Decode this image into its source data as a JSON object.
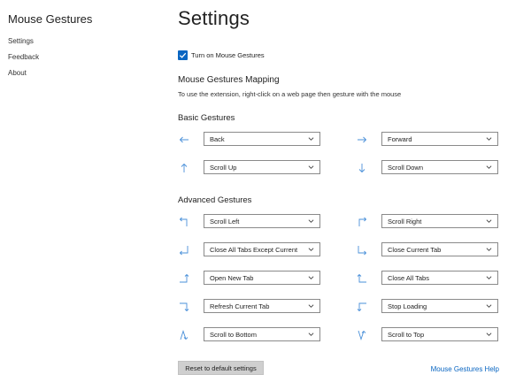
{
  "sidebar": {
    "title": "Mouse Gestures",
    "items": [
      {
        "label": "Settings"
      },
      {
        "label": "Feedback"
      },
      {
        "label": "About"
      }
    ]
  },
  "main": {
    "title": "Settings",
    "toggle": {
      "label": "Turn on Mouse Gestures",
      "checked": true
    },
    "mapping": {
      "title": "Mouse Gestures Mapping",
      "description": "To use the extension, right-click on a web page then gesture with the mouse"
    },
    "basic": {
      "title": "Basic Gestures",
      "gestures": [
        {
          "icon": "arrow-left-icon",
          "value": "Back"
        },
        {
          "icon": "arrow-right-icon",
          "value": "Forward"
        },
        {
          "icon": "arrow-up-icon",
          "value": "Scroll Up"
        },
        {
          "icon": "arrow-down-icon",
          "value": "Scroll Down"
        }
      ]
    },
    "advanced": {
      "title": "Advanced Gestures",
      "gestures": [
        {
          "icon": "up-left-icon",
          "value": "Scroll Left"
        },
        {
          "icon": "up-right-icon",
          "value": "Scroll Right"
        },
        {
          "icon": "down-left-icon",
          "value": "Close All Tabs Except Current"
        },
        {
          "icon": "down-right-icon",
          "value": "Close Current Tab"
        },
        {
          "icon": "right-up-icon",
          "value": "Open New Tab"
        },
        {
          "icon": "left-up-icon",
          "value": "Close All Tabs"
        },
        {
          "icon": "right-down-icon",
          "value": "Refresh Current Tab"
        },
        {
          "icon": "left-down-icon",
          "value": "Stop Loading"
        },
        {
          "icon": "up-down-icon",
          "value": "Scroll to Bottom"
        },
        {
          "icon": "down-up-icon",
          "value": "Scroll to Top"
        }
      ]
    },
    "reset_label": "Reset to default settings",
    "help_label": "Mouse Gestures Help"
  },
  "colors": {
    "accent": "#0a66c2",
    "icon": "#4a90d9",
    "button": "#cfcfcf"
  }
}
